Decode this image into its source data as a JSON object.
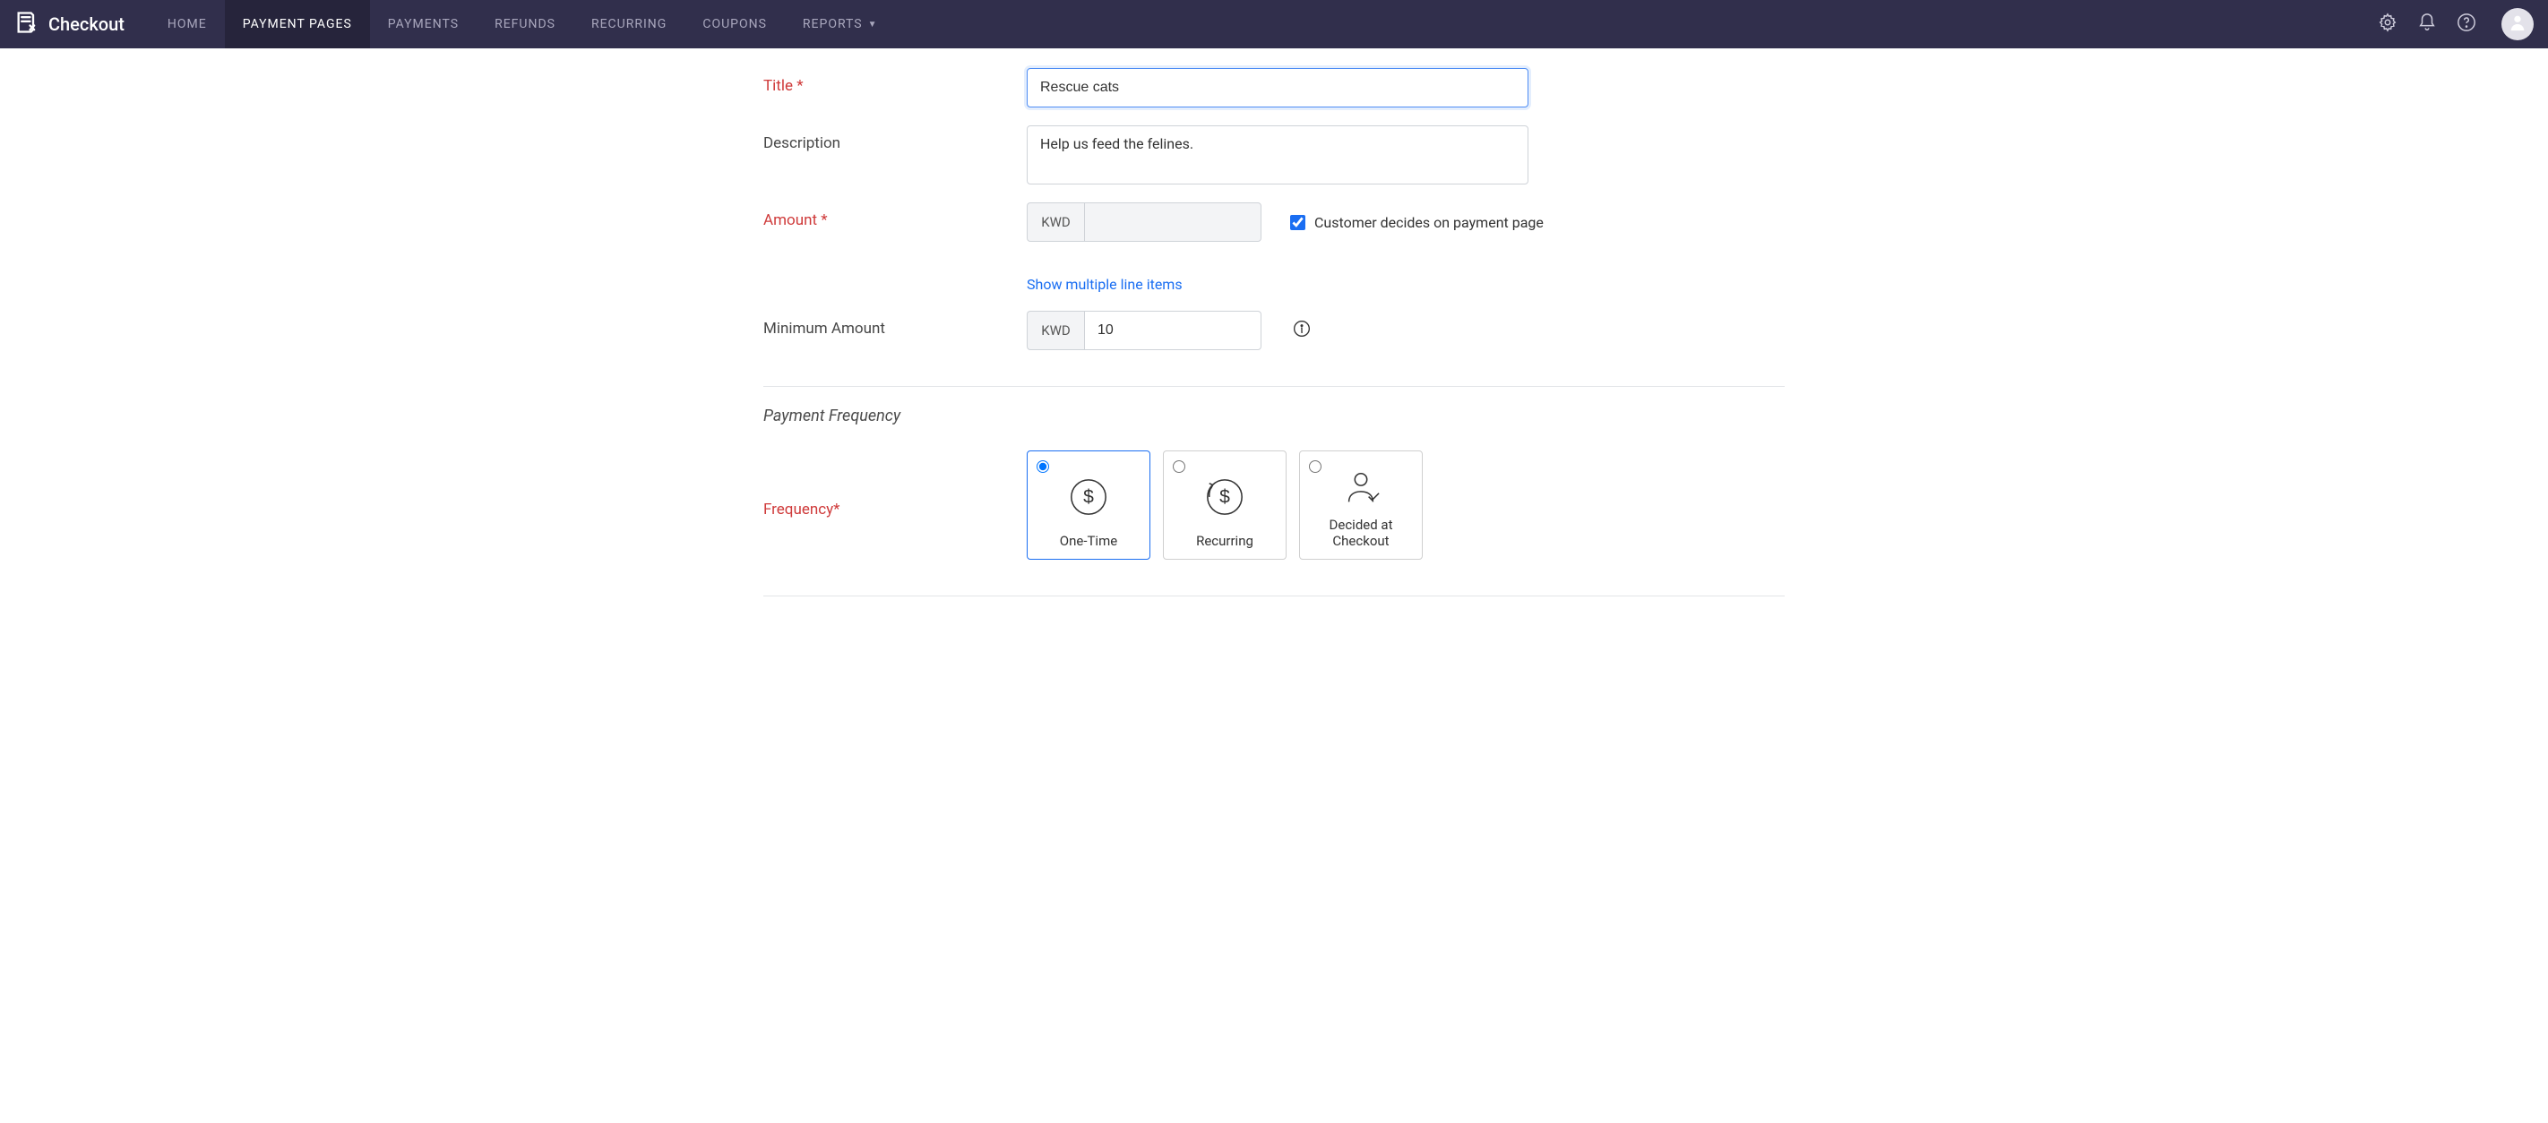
{
  "brand": {
    "name": "Checkout"
  },
  "nav": {
    "items": [
      {
        "label": "HOME",
        "active": false,
        "dropdown": false
      },
      {
        "label": "PAYMENT PAGES",
        "active": true,
        "dropdown": false
      },
      {
        "label": "PAYMENTS",
        "active": false,
        "dropdown": false
      },
      {
        "label": "REFUNDS",
        "active": false,
        "dropdown": false
      },
      {
        "label": "RECURRING",
        "active": false,
        "dropdown": false
      },
      {
        "label": "COUPONS",
        "active": false,
        "dropdown": false
      },
      {
        "label": "REPORTS",
        "active": false,
        "dropdown": true
      }
    ]
  },
  "form": {
    "title_label": "Title *",
    "title_value": "Rescue cats",
    "description_label": "Description",
    "description_value": "Help us feed the felines.",
    "amount_label": "Amount *",
    "currency": "KWD",
    "amount_value": "",
    "customer_decides_label": "Customer decides on payment page",
    "customer_decides_checked": true,
    "show_line_items_link": "Show multiple line items",
    "min_amount_label": "Minimum Amount",
    "min_amount_value": "10"
  },
  "frequency": {
    "section_heading": "Payment Frequency",
    "label": "Frequency*",
    "options": [
      {
        "label": "One-Time",
        "selected": true
      },
      {
        "label": "Recurring",
        "selected": false
      },
      {
        "label": "Decided at Checkout",
        "selected": false
      }
    ]
  }
}
